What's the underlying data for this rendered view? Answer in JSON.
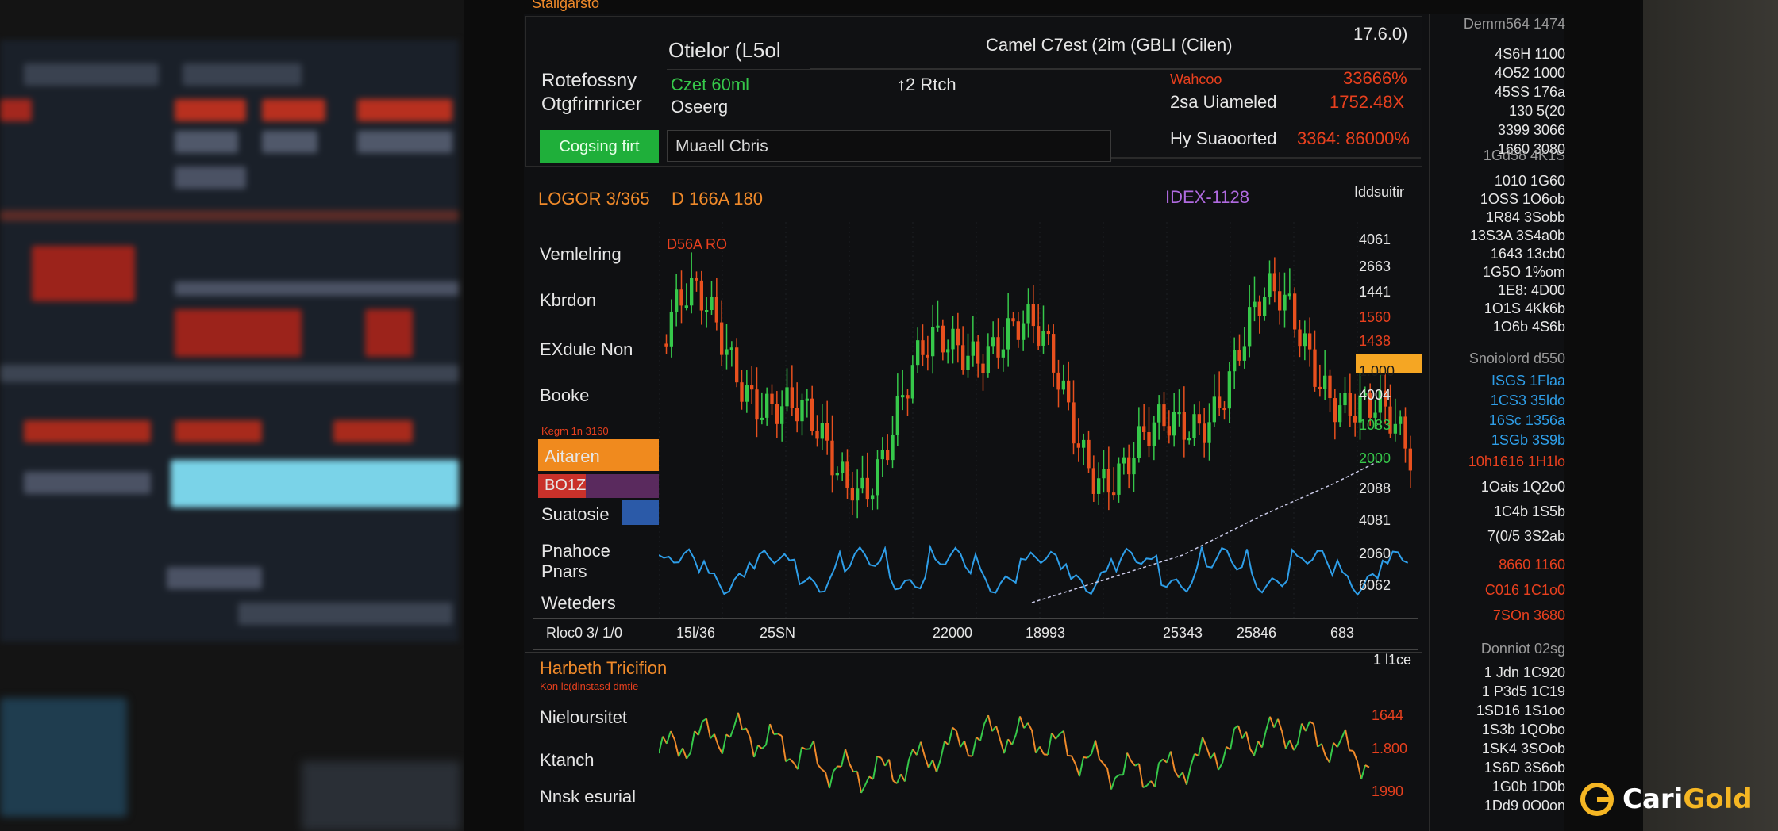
{
  "colors": {
    "up": "#36c84a",
    "down": "#e8501e",
    "accent": "#f08a2a",
    "blue": "#2e9ee8",
    "highlight": "#f5a623"
  },
  "window": {
    "title": "Stallgarsto"
  },
  "header": {
    "title_left": "Otielor (L5ol",
    "title_center": "Camel C7est  (2im  (GBLI (Cilen)",
    "title_right": "17.6.0)",
    "label1": "Rotefossny",
    "label2": "Otgfrirnricer",
    "value_green": "Czet 60ml",
    "value_sub": "Oseerg",
    "change": "↑2 Rtch",
    "status_red": "Wahcoo",
    "status_red_pct": "33666%",
    "updated_label": "2sa Uiameled",
    "updated_value": "1752.48X",
    "supported_label": "Hy Suaoorted",
    "supported_value": "3364: 86000%",
    "button": "Cogsing firt",
    "search_value": "Muaell Cbris"
  },
  "chart_header": {
    "left_code": "LOGOR 3/365",
    "left_value": "D 166A 180",
    "center": "IDEX-1128",
    "right": "Iddsuitir",
    "inset": "D56A RO"
  },
  "side_menu": {
    "items": [
      "Vemlelring",
      "Kbrdon",
      "EXdule Non",
      "Booke"
    ],
    "small_label": "Kegm 1n 3160",
    "orange_item": "Aitaren",
    "red_item": "BO1Z",
    "item_after": "Suatosie",
    "item_pp1": "Pnahoce",
    "item_pp2": "Pnars",
    "item_last": "Weteders"
  },
  "price_axis": [
    "4061",
    "2663",
    "1441",
    "1560",
    "1438",
    "1.000",
    "4004",
    "1083",
    "2000",
    "2088",
    "4081",
    "2060",
    "6062"
  ],
  "time_axis": [
    "Rloc0 3/ 1/0",
    "15l/36",
    "25SN",
    "22000",
    "18993",
    "25343",
    "25846",
    "683"
  ],
  "lower_panel": {
    "title": "Harbeth Tricifion",
    "subtitle": "Kon lc(dinstasd dmtie",
    "right_top": "1 l1ce",
    "items": [
      "Nieloursitet",
      "Ktanch",
      "Nnsk esurial"
    ],
    "axis": [
      "1644",
      "1.800",
      "1990"
    ]
  },
  "right_column": {
    "header": "Demm564  1474",
    "group1": [
      "4S6H 1100",
      "4O52 1000",
      "45SS 176a",
      "130 5(20",
      "3399 3066",
      "1660 3080"
    ],
    "section2": "1Gd58  4K1S",
    "group2": [
      "1010 1G60",
      "1OSS 1O6ob",
      "1R84 3Sobb",
      "13S3A 3S4a0b",
      "1643 13cb0",
      "1G5O 1%om",
      "1E8: 4D00",
      "1O1S 4Kk6b",
      "1O6b 4S6b"
    ],
    "section3": "Snoiolord d550",
    "group3_blue": [
      "ISGS 1Flaa",
      "1CS3 35ldo",
      "16Sc 1356a",
      "1SGb 3S9b"
    ],
    "group3_red": "10h1616 1H1lo",
    "group3_white": [
      "1Oais 1Q2o0",
      "1C4b 1S5b",
      "7(0/5 3S2ab"
    ],
    "group3_red2": [
      "8660 1160",
      "C016 1C1o0",
      "7SOn 3680"
    ],
    "section4": "Donniot 02sg",
    "group4": [
      "1 Jdn 1C920",
      "1 P3d5 1C19",
      "1SD16 1S1oo",
      "1S3b 1QObo",
      "1SK4 3SOob",
      "1S6D 3S6ob",
      "1G0b 1D0b",
      "1Dd9 0O0on"
    ]
  },
  "watermark": {
    "brand_part1": "Cari",
    "brand_part2": "Gold"
  }
}
